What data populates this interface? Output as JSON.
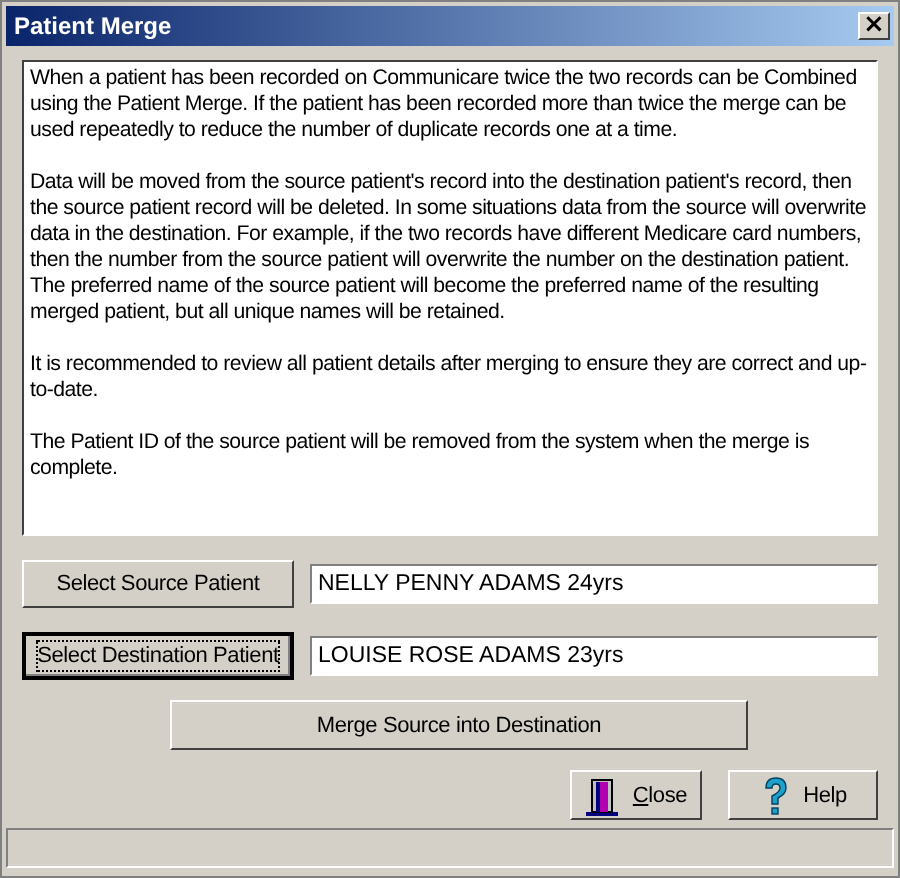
{
  "window": {
    "title": "Patient Merge",
    "close_glyph": "×"
  },
  "description": [
    "When a patient has been recorded on Communicare twice the two records can be Combined using the Patient Merge. If the patient has been recorded more than twice the merge can be used repeatedly to reduce the number of duplicate records one at a time.",
    "Data will be moved from the source patient's record into the destination patient's record, then the source patient record will be deleted. In some situations data from the source will overwrite data in the destination. For example, if the two records have different Medicare card numbers, then the number from the source patient will overwrite the number on the destination patient. The preferred name of the source patient will become the preferred name of the resulting merged patient, but all unique names will be retained.",
    "It is recommended to review all patient details after merging to ensure they are correct and up-to-date.",
    "The Patient ID of the source patient will be removed from the system when the merge is complete."
  ],
  "selectors": [
    {
      "button": "Select Source Patient",
      "focused": false,
      "value": "NELLY PENNY ADAMS 24yrs"
    },
    {
      "button": "Select Destination Patient",
      "focused": true,
      "value": "LOUISE ROSE ADAMS 23yrs"
    }
  ],
  "merge_button": "Merge Source into Destination",
  "footer_buttons": [
    {
      "kind": "close",
      "label": "Close"
    },
    {
      "kind": "help",
      "label": "Help"
    }
  ]
}
